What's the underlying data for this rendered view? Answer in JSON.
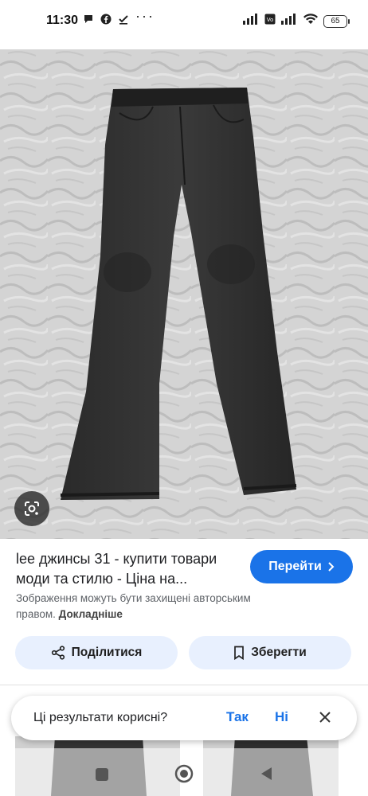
{
  "status_bar": {
    "time": "11:30",
    "battery": "65",
    "more": "···"
  },
  "result": {
    "title": "lee джинсы 31 - купити товари моди та стилю - Ціна на...",
    "visit_label": "Перейти",
    "copyright_text": "Зображення можуть бути захищені авторським правом.",
    "copyright_link": "Докладніше"
  },
  "actions": {
    "share_label": "Поділитися",
    "save_label": "Зберегти"
  },
  "feedback": {
    "question": "Ці результати корисні?",
    "yes_label": "Так",
    "no_label": "Ні"
  },
  "icons": {
    "lens": "google-lens-icon",
    "share": "share-icon",
    "bookmark": "bookmark-icon",
    "chevron": "chevron-right-icon",
    "close": "close-icon"
  },
  "colors": {
    "accent": "#1a73e8",
    "tonal_button": "#e8f0fe",
    "secondary_text": "#5f6368"
  }
}
